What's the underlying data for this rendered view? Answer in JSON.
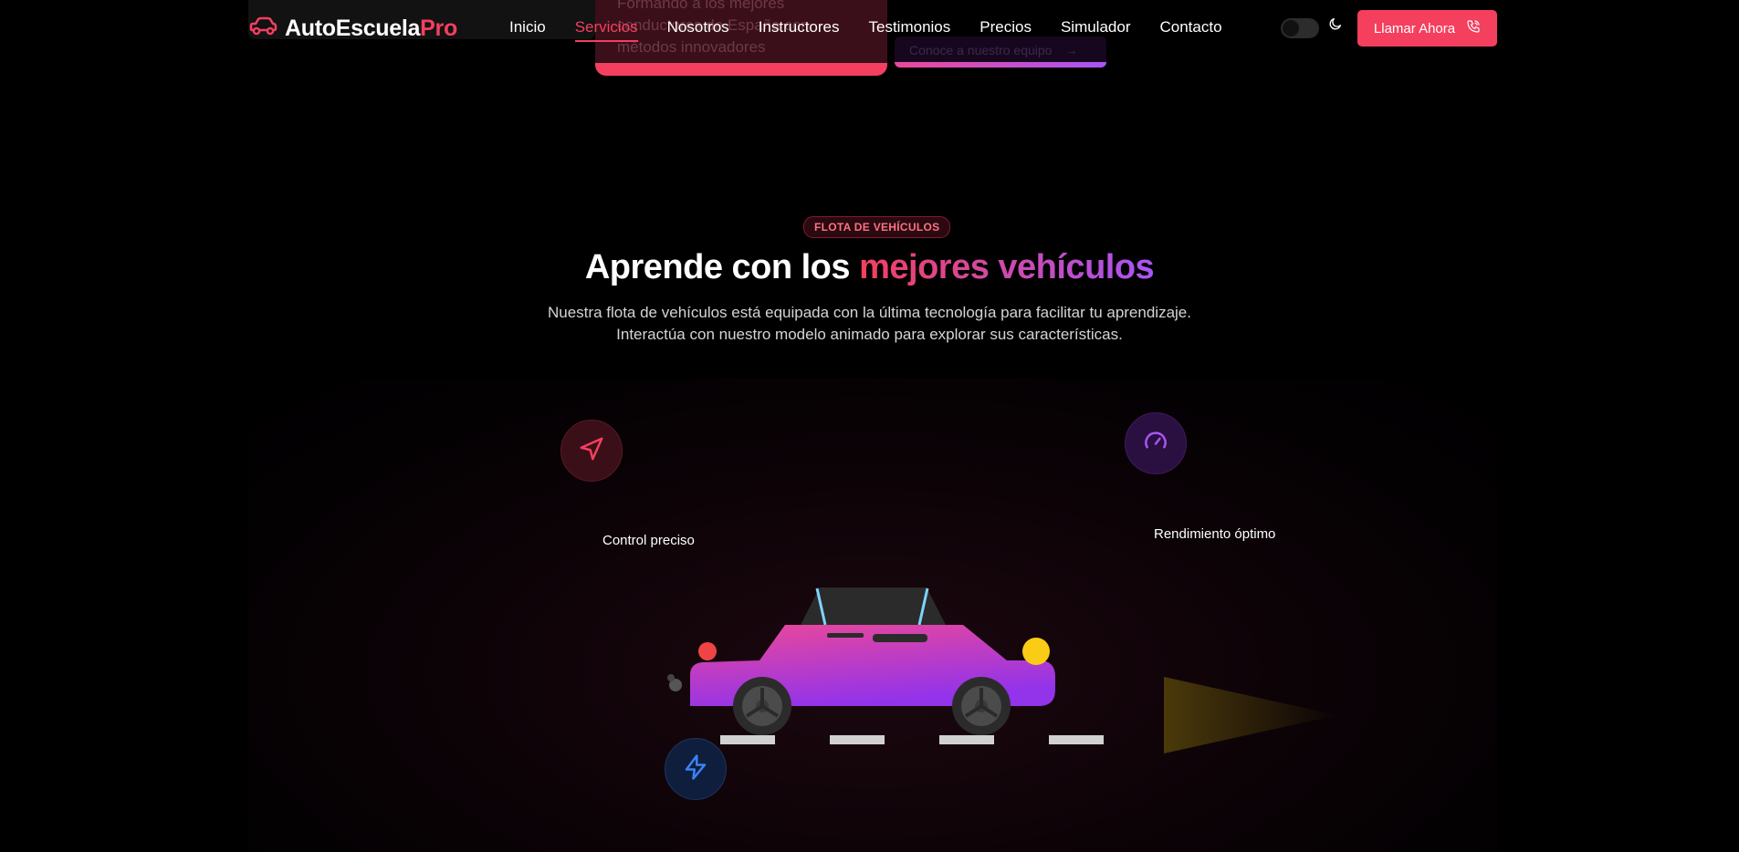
{
  "background_hint": {
    "card_text": "Formando a los mejores conductores de España con métodos innovadores",
    "team_button_label": "Conoce a nuestro equipo",
    "team_button_arrow": "→"
  },
  "header": {
    "brand": {
      "main": "AutoEscuela",
      "accent": "Pro",
      "icon": "car-icon"
    },
    "nav": [
      {
        "label": "Inicio",
        "active": false
      },
      {
        "label": "Servicios",
        "active": true
      },
      {
        "label": "Nosotros",
        "active": false
      },
      {
        "label": "Instructores",
        "active": false
      },
      {
        "label": "Testimonios",
        "active": false
      },
      {
        "label": "Precios",
        "active": false
      },
      {
        "label": "Simulador",
        "active": false
      },
      {
        "label": "Contacto",
        "active": false
      }
    ],
    "theme_toggle": {
      "icon": "moon-icon",
      "state": "off"
    },
    "call_button": {
      "label": "Llamar Ahora",
      "icon": "phone-icon"
    }
  },
  "section": {
    "badge": "FLOTA DE VEHÍCULOS",
    "title_plain": "Aprende con los",
    "title_highlight": "mejores vehículos",
    "subtitle_line1": "Nuestra flota de vehículos está equipada con la última tecnología para facilitar tu aprendizaje.",
    "subtitle_line2": "Interactúa con nuestro modelo animado para explorar sus características."
  },
  "showcase": {
    "features": [
      {
        "label": "Control preciso",
        "icon": "navigation-icon"
      },
      {
        "label": "Rendimiento óptimo",
        "icon": "gauge-icon"
      },
      {
        "label": "",
        "icon": "lightning-icon"
      }
    ]
  },
  "colors": {
    "accent": "#f43f5e",
    "purple": "#a855f7",
    "background": "#000000"
  }
}
